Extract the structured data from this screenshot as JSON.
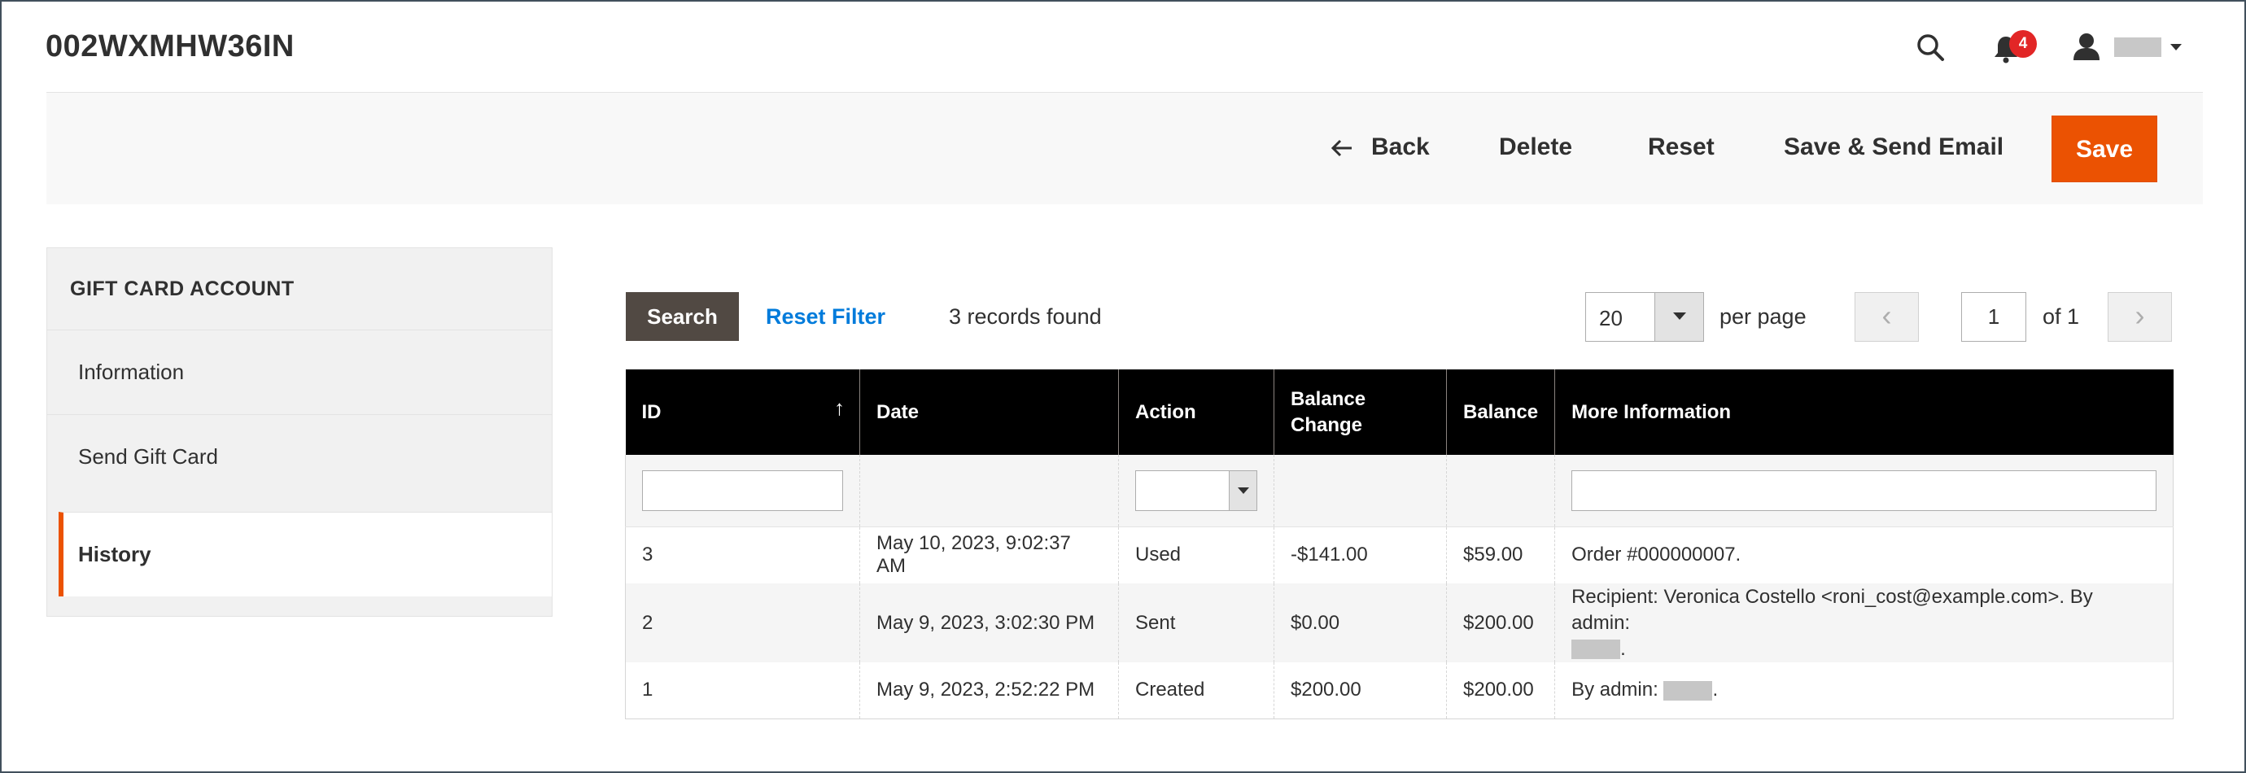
{
  "header": {
    "page_title": "002WXMHW36IN",
    "notification_count": "4"
  },
  "actions": {
    "back": "Back",
    "delete": "Delete",
    "reset": "Reset",
    "save_send": "Save & Send Email",
    "save": "Save"
  },
  "sidebar": {
    "title": "GIFT CARD ACCOUNT",
    "items": [
      {
        "label": "Information"
      },
      {
        "label": "Send Gift Card"
      },
      {
        "label": "History",
        "active": true
      }
    ]
  },
  "grid": {
    "search_button": "Search",
    "reset_filter": "Reset Filter",
    "records_found": "3 records found",
    "per_page_value": "20",
    "per_page_label": "per page",
    "page_current": "1",
    "page_of": "of 1",
    "columns": [
      "ID",
      "Date",
      "Action",
      "Balance Change",
      "Balance",
      "More Information"
    ],
    "sort_indicator": "↑",
    "rows": [
      {
        "id": "3",
        "date": "May 10, 2023, 9:02:37 AM",
        "action": "Used",
        "balance_change": "-$141.00",
        "balance": "$59.00",
        "info": "Order #000000007."
      },
      {
        "id": "2",
        "date": "May 9, 2023, 3:02:30 PM",
        "action": "Sent",
        "balance_change": "$0.00",
        "balance": "$200.00",
        "info": "Recipient: Veronica Costello <roni_cost@example.com>. By admin:"
      },
      {
        "id": "1",
        "date": "May 9, 2023, 2:52:22 PM",
        "action": "Created",
        "balance_change": "$200.00",
        "balance": "$200.00",
        "info": "By admin:"
      }
    ]
  },
  "colors": {
    "accent": "#eb5202",
    "link": "#007bdb",
    "search_button": "#514943",
    "header_bg": "#000000",
    "badge": "#e22626"
  }
}
